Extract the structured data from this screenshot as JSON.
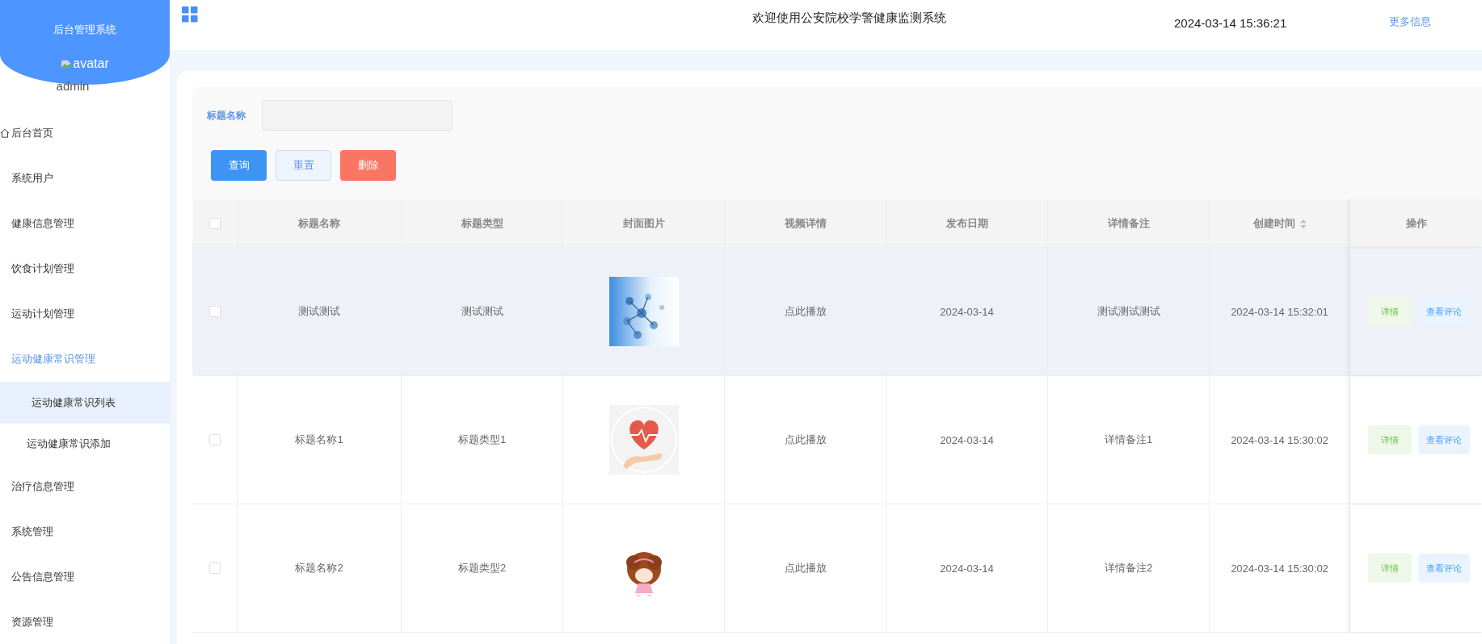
{
  "sidebar": {
    "title": "后台管理系统",
    "avatar_text": "avatar",
    "user": "admin",
    "items": [
      {
        "label": "后台首页",
        "kind": "home",
        "selected": false
      },
      {
        "label": "系统用户",
        "selected": false
      },
      {
        "label": "健康信息管理",
        "selected": false
      },
      {
        "label": "饮食计划管理",
        "selected": false
      },
      {
        "label": "运动计划管理",
        "selected": false
      },
      {
        "label": "运动健康常识管理",
        "selected": true,
        "expanded": true,
        "children": [
          {
            "label": "运动健康常识列表",
            "selected": true
          },
          {
            "label": "运动健康常识添加",
            "selected": false
          }
        ]
      },
      {
        "label": "治疗信息管理",
        "selected": false
      },
      {
        "label": "系统管理",
        "selected": false
      },
      {
        "label": "公告信息管理",
        "selected": false
      },
      {
        "label": "资源管理",
        "selected": false
      }
    ]
  },
  "header": {
    "title": "欢迎使用公安院校学警健康监测系统",
    "datetime": "2024-03-14 15:36:21",
    "link": "更多信息"
  },
  "search": {
    "label": "标题名称",
    "buttons": [
      {
        "label": "查询",
        "kind": "primary"
      },
      {
        "label": "重置",
        "kind": "plain"
      },
      {
        "label": "删除",
        "kind": "danger"
      }
    ]
  },
  "table": {
    "select_all_checked": false,
    "columns": [
      {
        "label": "标题名称",
        "sortable": false
      },
      {
        "label": "标题类型",
        "sortable": false
      },
      {
        "label": "封面图片",
        "sortable": false
      },
      {
        "label": "视频详情",
        "sortable": false
      },
      {
        "label": "发布日期",
        "sortable": false
      },
      {
        "label": "详情备注",
        "sortable": false
      },
      {
        "label": "创建时间",
        "sortable": true
      },
      {
        "label": "操作",
        "sortable": false
      }
    ],
    "rows": [
      {
        "checked": false,
        "highlighted": true,
        "title": "测试测试",
        "type": "测试测试",
        "video": "点此播放",
        "date": "2024-03-14",
        "remark": "测试测试测试",
        "created": "2024-03-14 15:32:01",
        "actions": [
          "详情",
          "查看评论"
        ]
      },
      {
        "checked": false,
        "highlighted": false,
        "title": "标题名称1",
        "type": "标题类型1",
        "video": "点此播放",
        "date": "2024-03-14",
        "remark": "详情备注1",
        "created": "2024-03-14 15:30:02",
        "actions": [
          "详情",
          "查看评论"
        ]
      },
      {
        "checked": false,
        "highlighted": false,
        "title": "标题名称2",
        "type": "标题类型2",
        "video": "点此播放",
        "date": "2024-03-14",
        "remark": "详情备注2",
        "created": "2024-03-14 15:30:02",
        "actions": [
          "详情",
          "查看评论"
        ]
      }
    ]
  }
}
